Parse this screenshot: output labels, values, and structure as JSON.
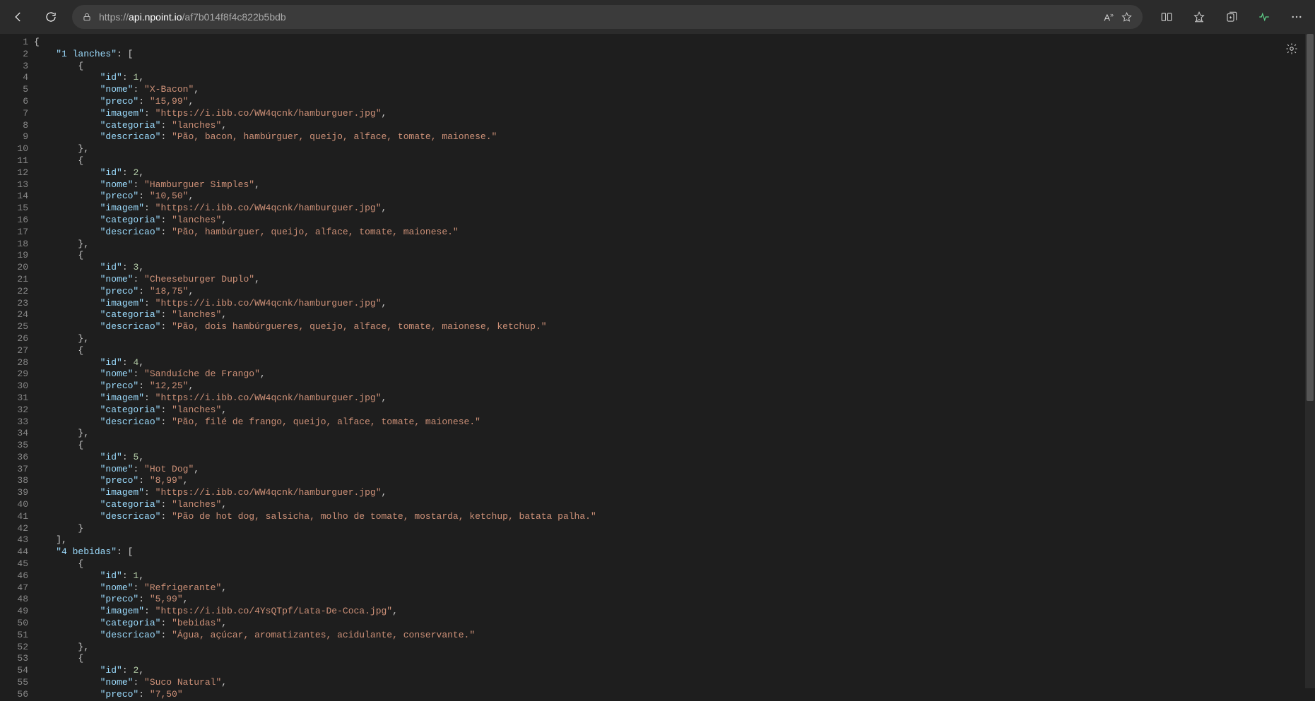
{
  "url": {
    "scheme": "https://",
    "host": "api.npoint.io",
    "path": "/af7b014f8f4c822b5bdb"
  },
  "json": {
    "1 lanches": [
      {
        "id": 1,
        "nome": "X-Bacon",
        "preco": "15,99",
        "imagem": "https://i.ibb.co/WW4qcnk/hamburguer.jpg",
        "categoria": "lanches",
        "descricao": "Pão, bacon, hambúrguer, queijo, alface, tomate, maionese."
      },
      {
        "id": 2,
        "nome": "Hamburguer Simples",
        "preco": "10,50",
        "imagem": "https://i.ibb.co/WW4qcnk/hamburguer.jpg",
        "categoria": "lanches",
        "descricao": "Pão, hambúrguer, queijo, alface, tomate, maionese."
      },
      {
        "id": 3,
        "nome": "Cheeseburger Duplo",
        "preco": "18,75",
        "imagem": "https://i.ibb.co/WW4qcnk/hamburguer.jpg",
        "categoria": "lanches",
        "descricao": "Pão, dois hambúrgueres, queijo, alface, tomate, maionese, ketchup."
      },
      {
        "id": 4,
        "nome": "Sanduíche de Frango",
        "preco": "12,25",
        "imagem": "https://i.ibb.co/WW4qcnk/hamburguer.jpg",
        "categoria": "lanches",
        "descricao": "Pão, filé de frango, queijo, alface, tomate, maionese."
      },
      {
        "id": 5,
        "nome": "Hot Dog",
        "preco": "8,99",
        "imagem": "https://i.ibb.co/WW4qcnk/hamburguer.jpg",
        "categoria": "lanches",
        "descricao": "Pão de hot dog, salsicha, molho de tomate, mostarda, ketchup, batata palha."
      }
    ],
    "4 bebidas": [
      {
        "id": 1,
        "nome": "Refrigerante",
        "preco": "5,99",
        "imagem": "https://i.ibb.co/4YsQTpf/Lata-De-Coca.jpg",
        "categoria": "bebidas",
        "descricao": "Água, açúcar, aromatizantes, acidulante, conservante."
      },
      {
        "id": 2,
        "nome": "Suco Natural",
        "preco": "7,50"
      }
    ]
  },
  "lineStart": 1,
  "lineEnd": 56
}
